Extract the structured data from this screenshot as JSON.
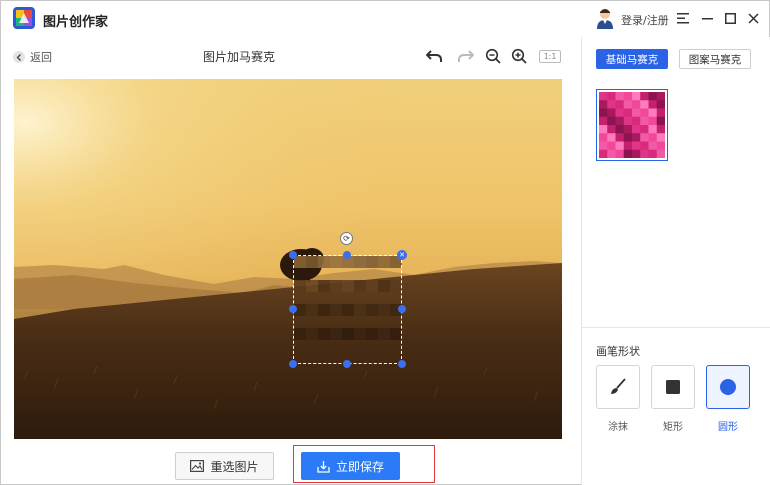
{
  "app": {
    "title": "图片创作家",
    "login": "登录/注册"
  },
  "editor": {
    "back_label": "返回",
    "title": "图片加马赛克",
    "ratio_label": "1:1"
  },
  "actions": {
    "reselect_label": "重选图片",
    "save_label": "立即保存"
  },
  "panel": {
    "tabs": [
      {
        "label": "基础马赛克",
        "active": true
      },
      {
        "label": "图案马赛克",
        "active": false
      }
    ],
    "brush_title": "画笔形状",
    "brushes": [
      {
        "label": "涂抹",
        "icon": "brush-icon",
        "active": false
      },
      {
        "label": "矩形",
        "icon": "square-icon",
        "active": false
      },
      {
        "label": "圆形",
        "icon": "circle-icon",
        "active": true
      }
    ]
  },
  "colors": {
    "accent": "#2b63e6",
    "save_button": "#2b7bf6",
    "highlight": "#e0393e"
  }
}
